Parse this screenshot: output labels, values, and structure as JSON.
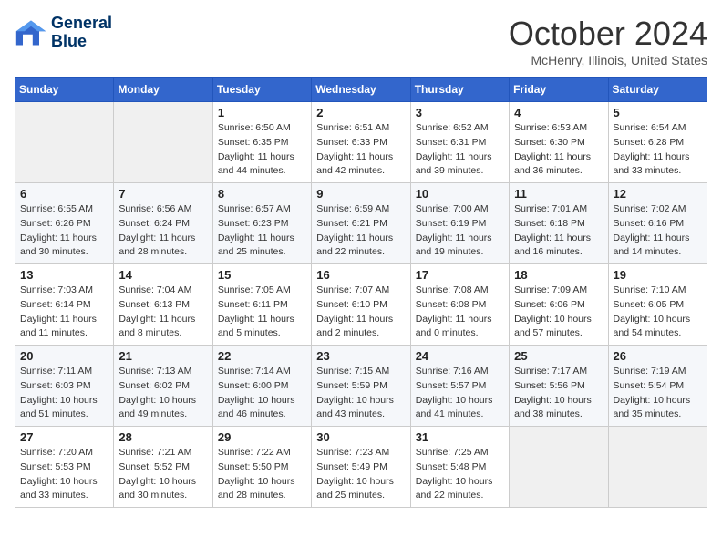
{
  "header": {
    "logo_line1": "General",
    "logo_line2": "Blue",
    "month_title": "October 2024",
    "location": "McHenry, Illinois, United States"
  },
  "weekdays": [
    "Sunday",
    "Monday",
    "Tuesday",
    "Wednesday",
    "Thursday",
    "Friday",
    "Saturday"
  ],
  "weeks": [
    [
      {
        "day": "",
        "info": ""
      },
      {
        "day": "",
        "info": ""
      },
      {
        "day": "1",
        "info": "Sunrise: 6:50 AM\nSunset: 6:35 PM\nDaylight: 11 hours and 44 minutes."
      },
      {
        "day": "2",
        "info": "Sunrise: 6:51 AM\nSunset: 6:33 PM\nDaylight: 11 hours and 42 minutes."
      },
      {
        "day": "3",
        "info": "Sunrise: 6:52 AM\nSunset: 6:31 PM\nDaylight: 11 hours and 39 minutes."
      },
      {
        "day": "4",
        "info": "Sunrise: 6:53 AM\nSunset: 6:30 PM\nDaylight: 11 hours and 36 minutes."
      },
      {
        "day": "5",
        "info": "Sunrise: 6:54 AM\nSunset: 6:28 PM\nDaylight: 11 hours and 33 minutes."
      }
    ],
    [
      {
        "day": "6",
        "info": "Sunrise: 6:55 AM\nSunset: 6:26 PM\nDaylight: 11 hours and 30 minutes."
      },
      {
        "day": "7",
        "info": "Sunrise: 6:56 AM\nSunset: 6:24 PM\nDaylight: 11 hours and 28 minutes."
      },
      {
        "day": "8",
        "info": "Sunrise: 6:57 AM\nSunset: 6:23 PM\nDaylight: 11 hours and 25 minutes."
      },
      {
        "day": "9",
        "info": "Sunrise: 6:59 AM\nSunset: 6:21 PM\nDaylight: 11 hours and 22 minutes."
      },
      {
        "day": "10",
        "info": "Sunrise: 7:00 AM\nSunset: 6:19 PM\nDaylight: 11 hours and 19 minutes."
      },
      {
        "day": "11",
        "info": "Sunrise: 7:01 AM\nSunset: 6:18 PM\nDaylight: 11 hours and 16 minutes."
      },
      {
        "day": "12",
        "info": "Sunrise: 7:02 AM\nSunset: 6:16 PM\nDaylight: 11 hours and 14 minutes."
      }
    ],
    [
      {
        "day": "13",
        "info": "Sunrise: 7:03 AM\nSunset: 6:14 PM\nDaylight: 11 hours and 11 minutes."
      },
      {
        "day": "14",
        "info": "Sunrise: 7:04 AM\nSunset: 6:13 PM\nDaylight: 11 hours and 8 minutes."
      },
      {
        "day": "15",
        "info": "Sunrise: 7:05 AM\nSunset: 6:11 PM\nDaylight: 11 hours and 5 minutes."
      },
      {
        "day": "16",
        "info": "Sunrise: 7:07 AM\nSunset: 6:10 PM\nDaylight: 11 hours and 2 minutes."
      },
      {
        "day": "17",
        "info": "Sunrise: 7:08 AM\nSunset: 6:08 PM\nDaylight: 11 hours and 0 minutes."
      },
      {
        "day": "18",
        "info": "Sunrise: 7:09 AM\nSunset: 6:06 PM\nDaylight: 10 hours and 57 minutes."
      },
      {
        "day": "19",
        "info": "Sunrise: 7:10 AM\nSunset: 6:05 PM\nDaylight: 10 hours and 54 minutes."
      }
    ],
    [
      {
        "day": "20",
        "info": "Sunrise: 7:11 AM\nSunset: 6:03 PM\nDaylight: 10 hours and 51 minutes."
      },
      {
        "day": "21",
        "info": "Sunrise: 7:13 AM\nSunset: 6:02 PM\nDaylight: 10 hours and 49 minutes."
      },
      {
        "day": "22",
        "info": "Sunrise: 7:14 AM\nSunset: 6:00 PM\nDaylight: 10 hours and 46 minutes."
      },
      {
        "day": "23",
        "info": "Sunrise: 7:15 AM\nSunset: 5:59 PM\nDaylight: 10 hours and 43 minutes."
      },
      {
        "day": "24",
        "info": "Sunrise: 7:16 AM\nSunset: 5:57 PM\nDaylight: 10 hours and 41 minutes."
      },
      {
        "day": "25",
        "info": "Sunrise: 7:17 AM\nSunset: 5:56 PM\nDaylight: 10 hours and 38 minutes."
      },
      {
        "day": "26",
        "info": "Sunrise: 7:19 AM\nSunset: 5:54 PM\nDaylight: 10 hours and 35 minutes."
      }
    ],
    [
      {
        "day": "27",
        "info": "Sunrise: 7:20 AM\nSunset: 5:53 PM\nDaylight: 10 hours and 33 minutes."
      },
      {
        "day": "28",
        "info": "Sunrise: 7:21 AM\nSunset: 5:52 PM\nDaylight: 10 hours and 30 minutes."
      },
      {
        "day": "29",
        "info": "Sunrise: 7:22 AM\nSunset: 5:50 PM\nDaylight: 10 hours and 28 minutes."
      },
      {
        "day": "30",
        "info": "Sunrise: 7:23 AM\nSunset: 5:49 PM\nDaylight: 10 hours and 25 minutes."
      },
      {
        "day": "31",
        "info": "Sunrise: 7:25 AM\nSunset: 5:48 PM\nDaylight: 10 hours and 22 minutes."
      },
      {
        "day": "",
        "info": ""
      },
      {
        "day": "",
        "info": ""
      }
    ]
  ]
}
